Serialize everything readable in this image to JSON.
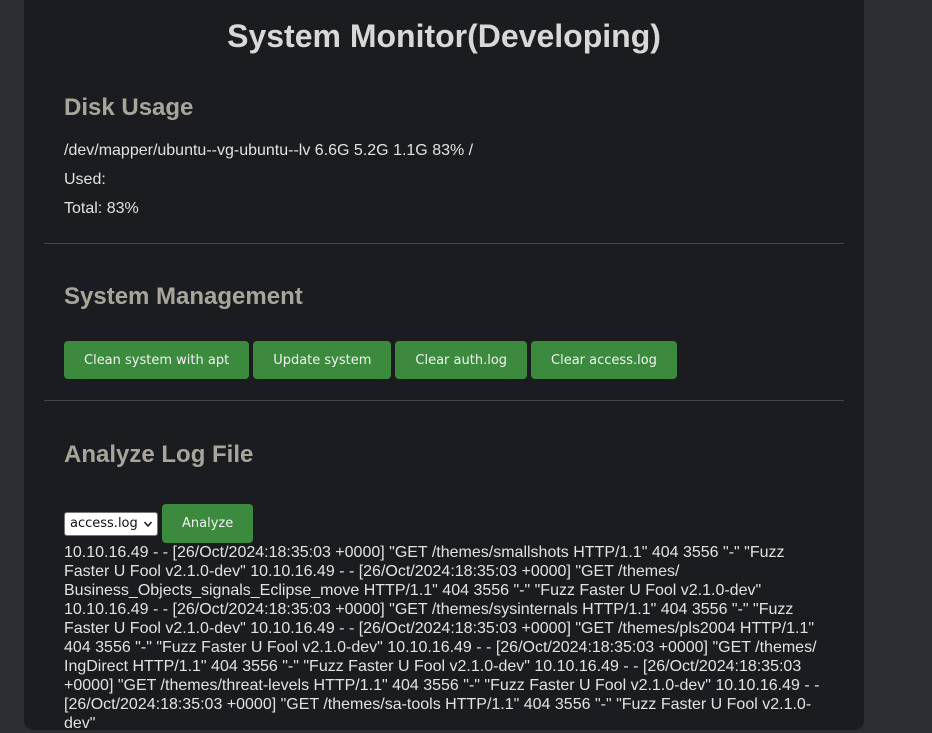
{
  "header": {
    "title": "System Monitor(Developing)"
  },
  "disk": {
    "heading": "Disk Usage",
    "filesystem_line": "/dev/mapper/ubuntu--vg-ubuntu--lv 6.6G 5.2G 1.1G 83% /",
    "used_line": "Used:",
    "total_line": "Total: 83%"
  },
  "management": {
    "heading": "System Management",
    "buttons": [
      {
        "label": "Clean system with apt"
      },
      {
        "label": "Update system"
      },
      {
        "label": "Clear auth.log"
      },
      {
        "label": "Clear access.log"
      }
    ]
  },
  "log": {
    "heading": "Analyze Log File",
    "selected_file": "access.log",
    "analyze_label": "Analyze",
    "output": "10.10.16.49 - - [26/Oct/2024:18:35:03 +0000] \"GET /themes/smallshots HTTP/1.1\" 404 3556 \"-\" \"Fuzz Faster U Fool v2.1.0-dev\" 10.10.16.49 - - [26/Oct/2024:18:35:03 +0000] \"GET /themes/ Business_Objects_signals_Eclipse_move HTTP/1.1\" 404 3556 \"-\" \"Fuzz Faster U Fool v2.1.0-dev\" 10.10.16.49 - - [26/Oct/2024:18:35:03 +0000] \"GET /themes/sysinternals HTTP/1.1\" 404 3556 \"-\" \"Fuzz Faster U Fool v2.1.0-dev\" 10.10.16.49 - - [26/Oct/2024:18:35:03 +0000] \"GET /themes/pls2004 HTTP/1.1\" 404 3556 \"-\" \"Fuzz Faster U Fool v2.1.0-dev\" 10.10.16.49 - - [26/Oct/2024:18:35:03 +0000] \"GET /themes/ IngDirect HTTP/1.1\" 404 3556 \"-\" \"Fuzz Faster U Fool v2.1.0-dev\" 10.10.16.49 - - [26/Oct/2024:18:35:03 +0000] \"GET /themes/threat-levels HTTP/1.1\" 404 3556 \"-\" \"Fuzz Faster U Fool v2.1.0-dev\" 10.10.16.49 - - [26/Oct/2024:18:35:03 +0000] \"GET /themes/sa-tools HTTP/1.1\" 404 3556 \"-\" \"Fuzz Faster U Fool v2.1.0-dev\""
  }
}
